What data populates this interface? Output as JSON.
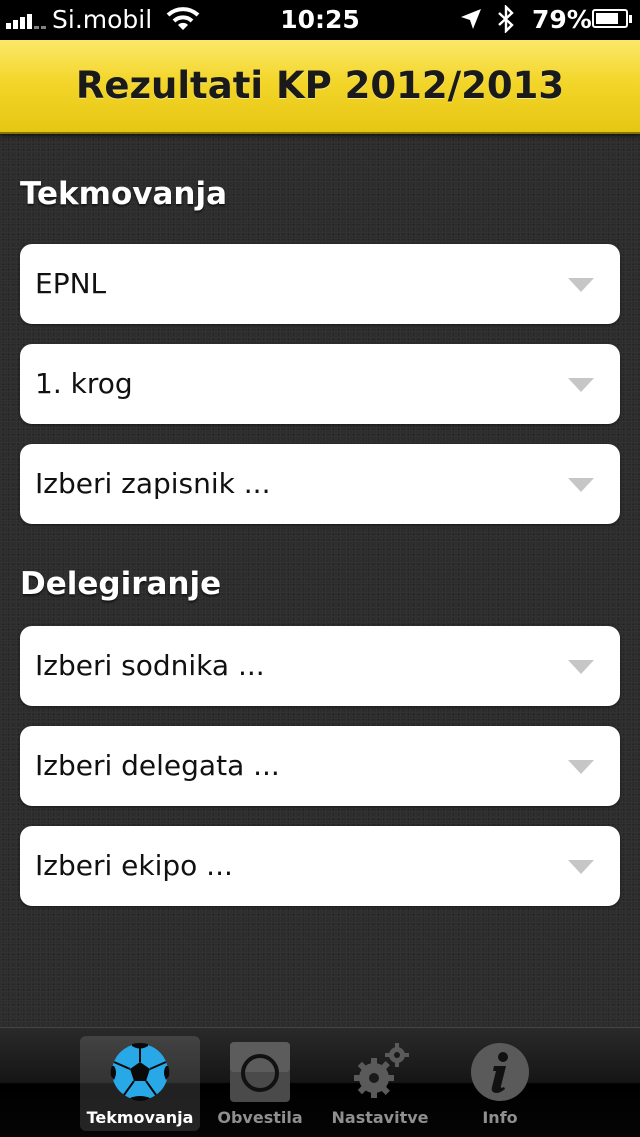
{
  "status_bar": {
    "carrier": "Si.mobil",
    "time": "10:25",
    "battery_percent": "79%",
    "battery_level": 0.79
  },
  "nav": {
    "title": "Rezultati KP 2012/2013"
  },
  "sections": {
    "competitions": {
      "header": "Tekmovanja",
      "pickers": [
        "EPNL",
        "1. krog",
        "Izberi zapisnik ..."
      ]
    },
    "delegation": {
      "header": "Delegiranje",
      "pickers": [
        "Izberi sodnika ...",
        "Izberi delegata ...",
        "Izberi ekipo ..."
      ]
    }
  },
  "tab_bar": {
    "items": [
      {
        "label": "Tekmovanja",
        "icon": "soccer-ball-icon",
        "selected": true
      },
      {
        "label": "Obvestila",
        "icon": "circle-notice-icon",
        "selected": false
      },
      {
        "label": "Nastavitve",
        "icon": "gears-icon",
        "selected": false
      },
      {
        "label": "Info",
        "icon": "info-icon",
        "selected": false
      }
    ]
  },
  "colors": {
    "nav_yellow": "#f3d62a",
    "tab_active_blue": "#29a8e8",
    "picker_arrow": "#c6c6c6"
  }
}
